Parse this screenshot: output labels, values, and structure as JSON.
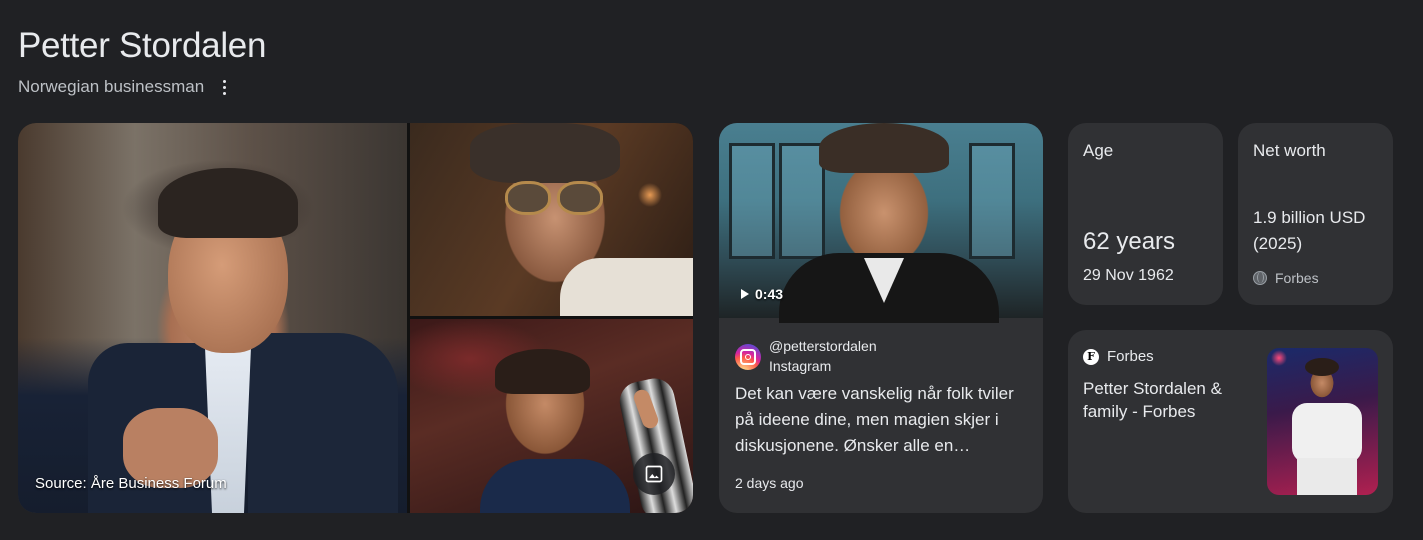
{
  "header": {
    "title": "Petter Stordalen",
    "subtitle": "Norwegian businessman"
  },
  "images": {
    "main_source": "Source: Åre Business Forum"
  },
  "video": {
    "duration": "0:43",
    "account": "@petterstordalen",
    "platform": "Instagram",
    "description": "Det kan være vanskelig når folk tviler på ideene dine, men magien skjer i diskusjonene. Ønsker alle en…",
    "time_ago": "2 days ago"
  },
  "facts": {
    "age_label": "Age",
    "age_value": "62 years",
    "birth_date": "29 Nov 1962",
    "net_worth_label": "Net worth",
    "net_worth_value": "1.9 billion USD (2025)",
    "net_worth_source": "Forbes"
  },
  "article": {
    "source": "Forbes",
    "source_icon_letter": "F",
    "title": "Petter Stordalen & family - Forbes"
  },
  "icons": {
    "more": "more-vert-icon",
    "gallery": "image-gallery-icon",
    "play": "play-icon",
    "instagram": "instagram-icon",
    "globe": "globe-icon",
    "forbes": "forbes-f-icon"
  }
}
